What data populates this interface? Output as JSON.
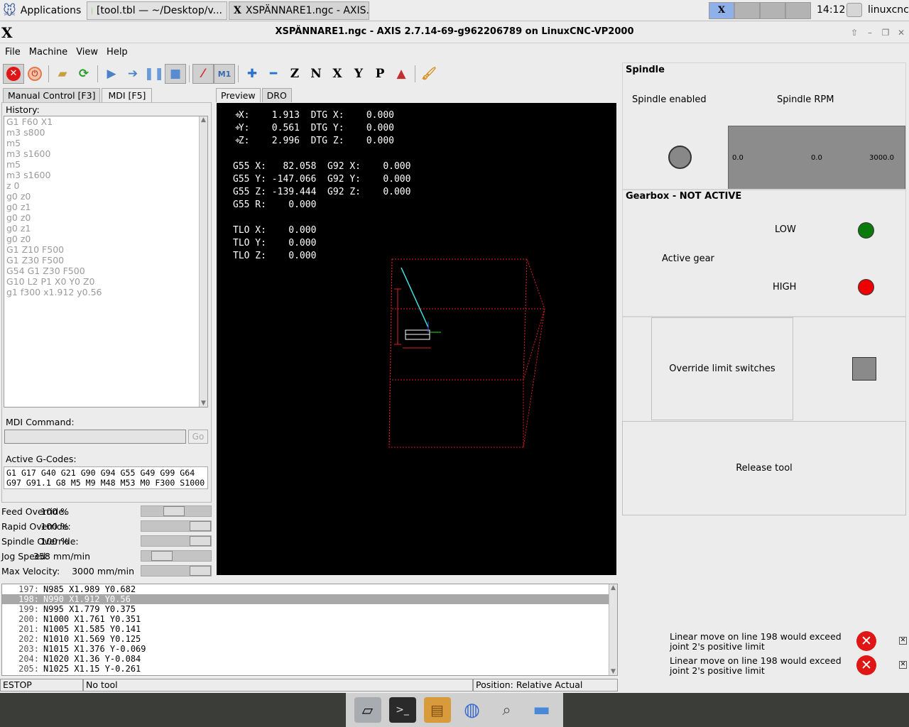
{
  "taskbar": {
    "apps_label": "Applications",
    "tasks": [
      {
        "label": "[tool.tbl — ~/Desktop/v..."
      },
      {
        "label": "XSPÄNNARE1.ngc - AXIS..."
      }
    ],
    "clock": "14:12",
    "user": "linuxcnc"
  },
  "window": {
    "title": "XSPÄNNARE1.ngc - AXIS 2.7.14-69-g962206789 on LinuxCNC-VP2000",
    "logo": "X"
  },
  "menu": [
    "File",
    "Machine",
    "View",
    "Help"
  ],
  "left_tabs": [
    {
      "label": "Manual Control [F3]"
    },
    {
      "label": "MDI [F5]"
    }
  ],
  "history": {
    "label": "History:",
    "items": [
      "G1 F60 X1",
      "m3 s800",
      "m5",
      "m3 s1600",
      "m5",
      "m3 s1600",
      "z 0",
      "g0 z0",
      "g0 z1",
      "g0 z0",
      "g0 z1",
      "g0 z0",
      "G1 Z10 F500",
      "G1 Z30 F500",
      "G54 G1 Z30 F500",
      "G10 L2 P1 X0 Y0 Z0",
      "g1 f300 x1.912 y0.56"
    ]
  },
  "mdi": {
    "label": "MDI Command:",
    "value": "",
    "go": "Go"
  },
  "active_gcodes": {
    "label": "Active G-Codes:",
    "line1": "G1 G17 G40 G21 G90 G94 G55 G49 G99 G64",
    "line2": "G97 G91.1 G8 M5 M9 M48 M53 M0 F300 S1000"
  },
  "overrides": [
    {
      "label": "Feed Override:",
      "value": "100 %",
      "level": 0.45
    },
    {
      "label": "Rapid Override:",
      "value": "100 %",
      "level": 1.0
    },
    {
      "label": "Spindle Override:",
      "value": "100 %",
      "level": 1.0
    },
    {
      "label": "Jog Speed:",
      "value": "358 mm/min",
      "level": 0.2
    },
    {
      "label": "Max Velocity:",
      "value": "3000 mm/min",
      "level": 1.0
    }
  ],
  "view_tabs": [
    {
      "label": "Preview"
    },
    {
      "label": "DRO"
    }
  ],
  "dro_text": " X:    1.913  DTG X:    0.000\n Y:    0.561  DTG Y:    0.000\n Z:    2.996  DTG Z:    0.000\n\nG55 X:   82.058  G92 X:    0.000\nG55 Y: -147.066  G92 Y:    0.000\nG55 Z: -139.444  G92 Z:    0.000\nG55 R:    0.000\n\nTLO X:    0.000\nTLO Y:    0.000\nTLO Z:    0.000",
  "code_lines": [
    {
      "n": "197:",
      "text": "N985 X1.989 Y0.682"
    },
    {
      "n": "198:",
      "text": "N990 X1.912 Y0.56",
      "current": true
    },
    {
      "n": "199:",
      "text": "N995 X1.779 Y0.375"
    },
    {
      "n": "200:",
      "text": "N1000 X1.761 Y0.351"
    },
    {
      "n": "201:",
      "text": "N1005 X1.585 Y0.141"
    },
    {
      "n": "202:",
      "text": "N1010 X1.569 Y0.125"
    },
    {
      "n": "203:",
      "text": "N1015 X1.376 Y-0.069"
    },
    {
      "n": "204:",
      "text": "N1020 X1.36 Y-0.084"
    },
    {
      "n": "205:",
      "text": "N1025 X1.15 Y-0.261"
    }
  ],
  "status": {
    "state": "ESTOP",
    "tool": "No tool",
    "position": "Position: Relative Actual"
  },
  "spindle": {
    "title": "Spindle",
    "enabled_label": "Spindle enabled",
    "rpm_label": "Spindle RPM",
    "rpm_min": "0.0",
    "rpm_value": "0.0",
    "rpm_max": "3000.0"
  },
  "gearbox": {
    "title": "Gearbox - NOT ACTIVE",
    "active_label": "Active gear",
    "low_label": "LOW",
    "high_label": "HIGH",
    "low_color": "#0a7a0a",
    "high_color": "#ee0000"
  },
  "buttons": {
    "override_limits": "Override limit switches",
    "release_tool": "Release tool"
  },
  "errors": [
    {
      "text": "Linear move on line 198 would exceed joint 2's positive limit"
    },
    {
      "text": "Linear move on line 198 would exceed joint 2's positive limit"
    }
  ],
  "toolbar_icons": [
    "estop-icon",
    "power-icon",
    "open-file-icon",
    "reload-icon",
    "run-icon",
    "step-icon",
    "pause-icon",
    "stop-icon",
    "block-delete-icon",
    "optional-stop-icon",
    "zoom-in-icon",
    "zoom-out-icon",
    "view-z-icon",
    "view-z2-icon",
    "view-x-icon",
    "view-y-icon",
    "view-p-icon",
    "rotate-icon",
    "clear-plot-icon"
  ]
}
